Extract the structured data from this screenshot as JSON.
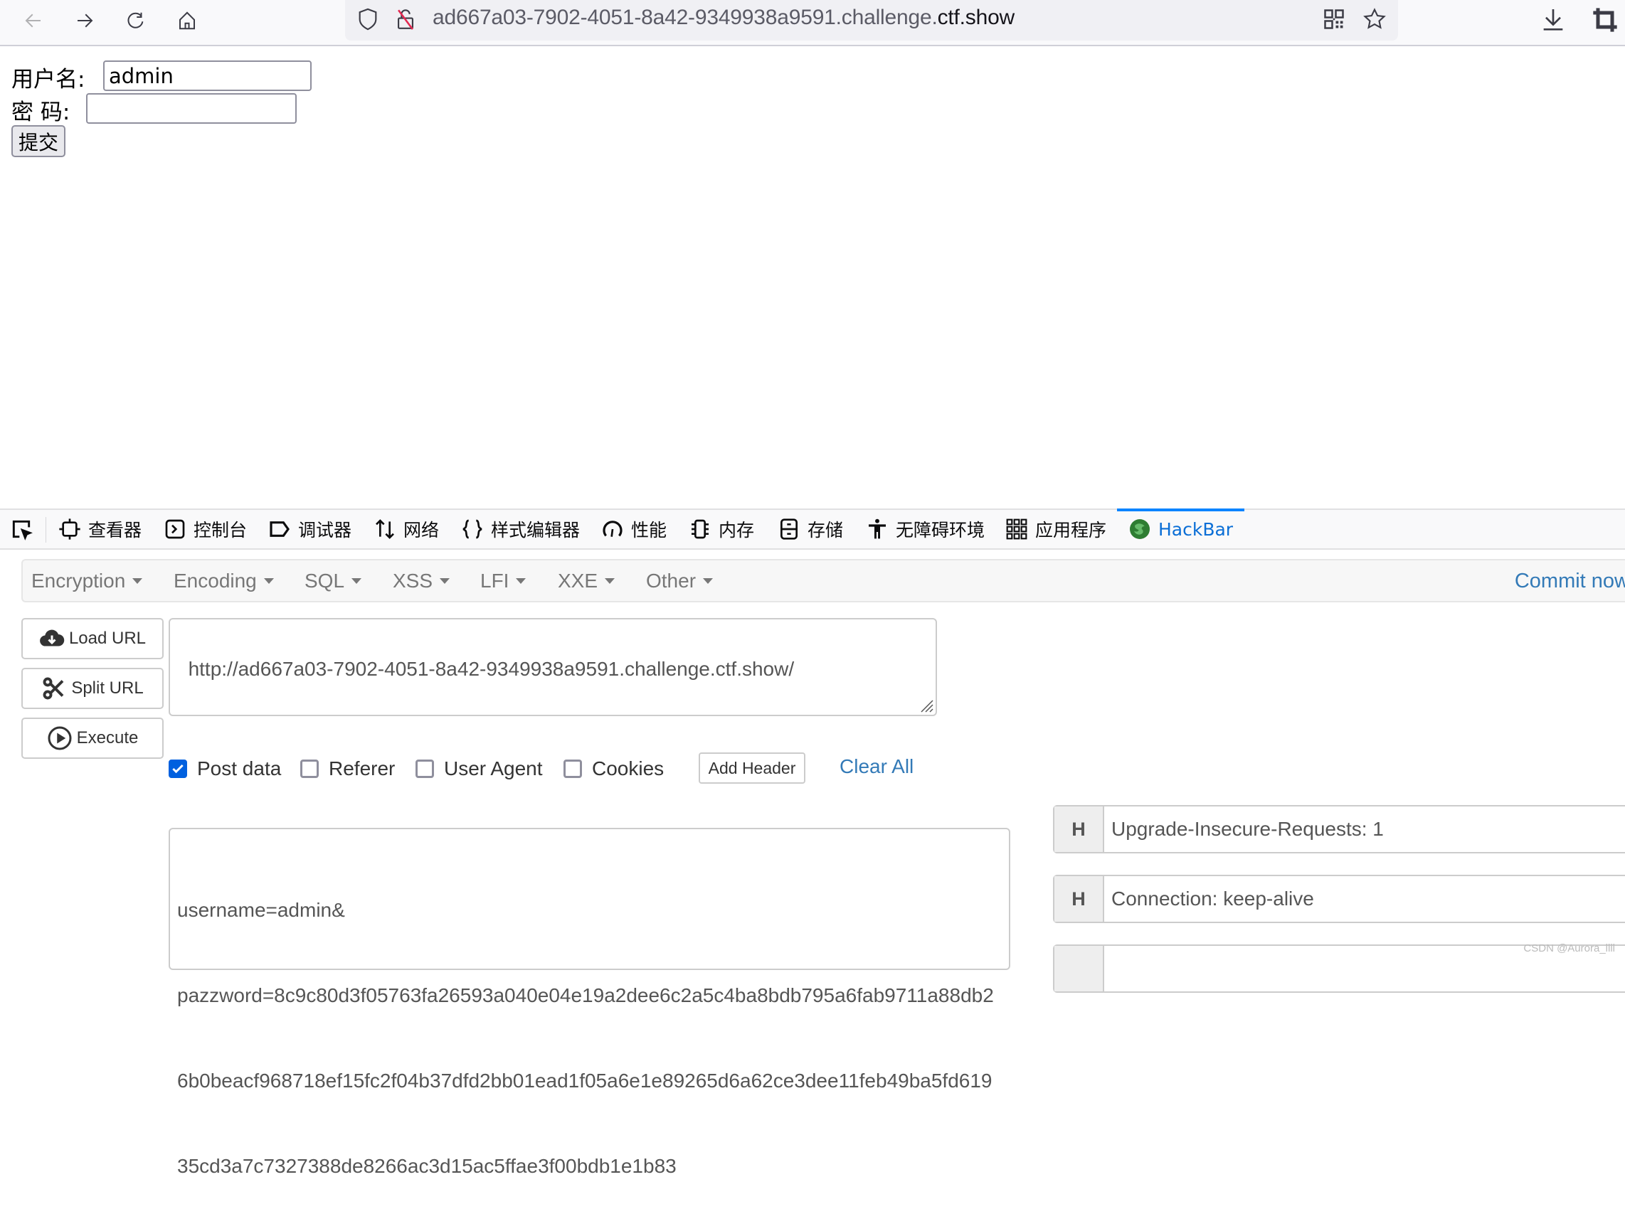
{
  "browser": {
    "url_prefix": "ad667a03-7902-4051-8a42-9349938a9591.challenge.",
    "url_domain": "ctf.show",
    "icons": [
      "back-arrow-icon",
      "forward-arrow-icon",
      "reload-icon",
      "home-icon",
      "shield-icon",
      "insecure-lock-icon",
      "qr-code-icon",
      "bookmark-star-icon",
      "download-icon",
      "crop-icon"
    ]
  },
  "page": {
    "username_label": "用户名:",
    "username_value": "admin",
    "password_label": "密 码:",
    "password_value": "",
    "submit_label": "提交"
  },
  "devtools": {
    "tabs": [
      {
        "label": "查看器",
        "icon": "inspector-icon"
      },
      {
        "label": "控制台",
        "icon": "console-icon"
      },
      {
        "label": "调试器",
        "icon": "debugger-icon"
      },
      {
        "label": "网络",
        "icon": "network-icon"
      },
      {
        "label": "样式编辑器",
        "icon": "style-editor-icon"
      },
      {
        "label": "性能",
        "icon": "performance-icon"
      },
      {
        "label": "内存",
        "icon": "memory-icon"
      },
      {
        "label": "存储",
        "icon": "storage-icon"
      },
      {
        "label": "无障碍环境",
        "icon": "accessibility-icon"
      },
      {
        "label": "应用程序",
        "icon": "application-icon"
      },
      {
        "label": "HackBar",
        "icon": "hackbar-icon",
        "active": true
      }
    ]
  },
  "hackbar": {
    "menu": [
      "Encryption",
      "Encoding",
      "SQL",
      "XSS",
      "LFI",
      "XXE",
      "Other"
    ],
    "commit_label": "Commit now",
    "load_url_label": "Load URL",
    "split_url_label": "Split URL",
    "execute_label": "Execute",
    "url_value": "http://ad667a03-7902-4051-8a42-9349938a9591.challenge.ctf.show/",
    "options": [
      {
        "label": "Post data",
        "checked": true
      },
      {
        "label": "Referer",
        "checked": false
      },
      {
        "label": "User Agent",
        "checked": false
      },
      {
        "label": "Cookies",
        "checked": false
      }
    ],
    "add_header_label": "Add Header",
    "clear_all_label": "Clear All",
    "post_lines": [
      "username=admin&",
      "pazzword=8c9c80d3f05763fa26593a040e04e19a2dee6c2a5c4ba8bdb795a6fab9711a88db2",
      "6b0beacf968718ef15fc2f04b37dfd2bb01ead1f05a6e1e89265d6a62ce3dee11feb49ba5fd619",
      "35cd3a7c7327388de8266ac3d15ac5ffae3f00bdb1e1b83"
    ],
    "headers": [
      {
        "tag": "H",
        "value": "Upgrade-Insecure-Requests: 1"
      },
      {
        "tag": "H",
        "value": "Connection: keep-alive"
      },
      {
        "tag": "",
        "value": ""
      }
    ]
  },
  "watermark": "CSDN @Aurora_llll"
}
